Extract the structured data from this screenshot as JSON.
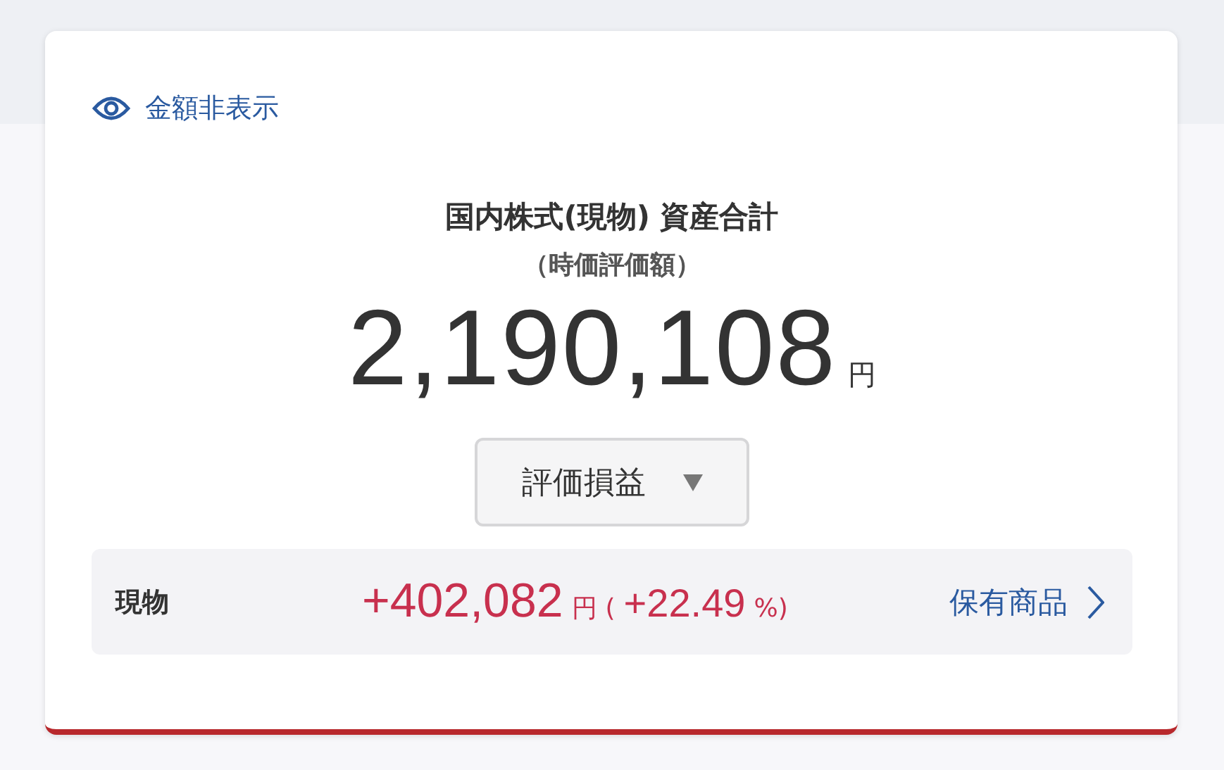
{
  "visibility_toggle": {
    "label": "金額非表示"
  },
  "summary": {
    "title": "国内株式(現物) 資産合計",
    "subtitle": "（時価評価額）",
    "amount": "2,190,108",
    "unit": "円"
  },
  "view_select": {
    "value": "評価損益"
  },
  "holdings_row": {
    "label": "現物",
    "gain": "+402,082",
    "gain_unit": "円",
    "open_paren": "(",
    "rate": "+22.49",
    "close": "%)",
    "link": "保有商品"
  }
}
